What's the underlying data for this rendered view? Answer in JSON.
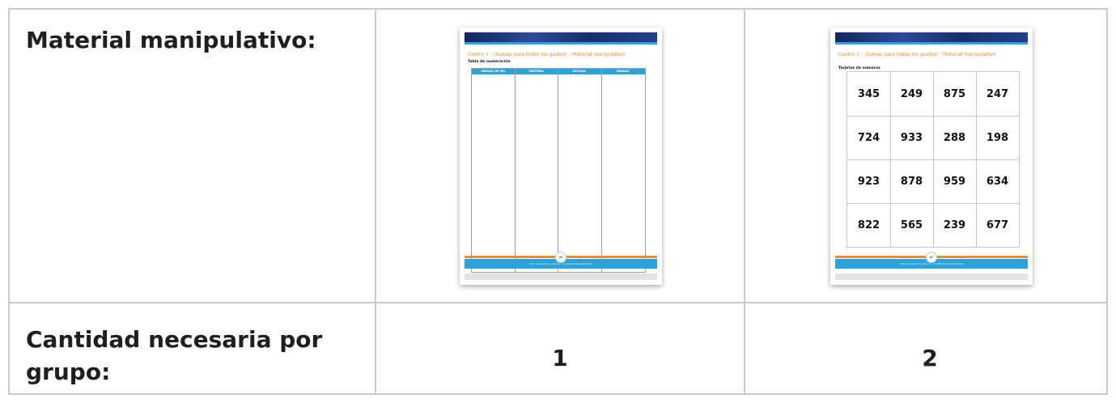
{
  "row1": {
    "label": "Material manipulativo:"
  },
  "row2": {
    "label": "Cantidad necesaria por grupo:",
    "qty1": "1",
    "qty2": "2"
  },
  "page1": {
    "title": "Centro 1 - ¡Sumas para todos los gustos! - Material manipulativo",
    "subtitle": "Tabla de numeración",
    "headers": [
      "UNIDAD DE MIL",
      "CENTENA",
      "DECENA",
      "UNIDAD"
    ],
    "page_number": "65",
    "footer": "Una cosa para ti y Zenon - Cuaderno del estudiante"
  },
  "page2": {
    "title": "Centro 1 - ¡Sumas para todos los gustos! - Material manipulativo",
    "subtitle": "Tarjetas de números",
    "numbers": [
      "345",
      "249",
      "875",
      "247",
      "724",
      "933",
      "288",
      "198",
      "923",
      "878",
      "959",
      "634",
      "822",
      "565",
      "239",
      "677"
    ],
    "page_number": "67",
    "footer": "Una cosa para ti y Zenon - Cuaderno del estudiante"
  }
}
